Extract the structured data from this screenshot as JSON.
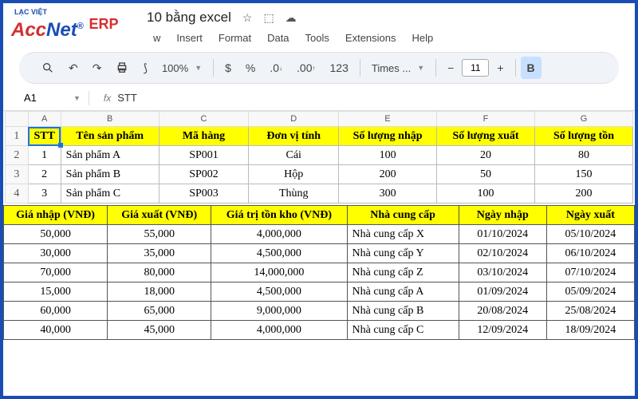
{
  "logo": {
    "lac": "LẠC VIỆT",
    "acc": "Acc",
    "net": "Net",
    "erp": "ERP",
    "reg": "®"
  },
  "doc": {
    "title": "10 bằng excel"
  },
  "menu": [
    "w",
    "Insert",
    "Format",
    "Data",
    "Tools",
    "Extensions",
    "Help"
  ],
  "toolbar": {
    "zoom": "100%",
    "font": "Times ...",
    "size": "11"
  },
  "namebox": "A1",
  "formula": "STT",
  "cols1": [
    "A",
    "B",
    "C",
    "D",
    "E",
    "F",
    "G"
  ],
  "headers1": [
    "STT",
    "Tên sản phẩm",
    "Mã hàng",
    "Đơn vị tính",
    "Số lượng nhập",
    "Số lượng xuất",
    "Số lượng tồn"
  ],
  "rows1": [
    {
      "n": "1",
      "stt": "1",
      "ten": "Sản phẩm A",
      "ma": "SP001",
      "dv": "Cái",
      "nhap": "100",
      "xuat": "20",
      "ton": "80"
    },
    {
      "n": "2",
      "stt": "2",
      "ten": "Sản phẩm B",
      "ma": "SP002",
      "dv": "Hộp",
      "nhap": "200",
      "xuat": "50",
      "ton": "150"
    },
    {
      "n": "3",
      "stt": "3",
      "ten": "Sản phẩm C",
      "ma": "SP003",
      "dv": "Thùng",
      "nhap": "300",
      "xuat": "100",
      "ton": "200"
    }
  ],
  "headers2": [
    "Giá nhập (VNĐ)",
    "Giá xuất (VNĐ)",
    "Giá trị tồn kho (VNĐ)",
    "Nhà cung cấp",
    "Ngày nhập",
    "Ngày xuất"
  ],
  "rows2": [
    {
      "gn": "50,000",
      "gx": "55,000",
      "gt": "4,000,000",
      "ncc": "Nhà cung cấp X",
      "nn": "01/10/2024",
      "nx": "05/10/2024"
    },
    {
      "gn": "30,000",
      "gx": "35,000",
      "gt": "4,500,000",
      "ncc": "Nhà cung cấp Y",
      "nn": "02/10/2024",
      "nx": "06/10/2024"
    },
    {
      "gn": "70,000",
      "gx": "80,000",
      "gt": "14,000,000",
      "ncc": "Nhà cung cấp Z",
      "nn": "03/10/2024",
      "nx": "07/10/2024"
    },
    {
      "gn": "15,000",
      "gx": "18,000",
      "gt": "4,500,000",
      "ncc": "Nhà cung cấp A",
      "nn": "01/09/2024",
      "nx": "05/09/2024"
    },
    {
      "gn": "60,000",
      "gx": "65,000",
      "gt": "9,000,000",
      "ncc": "Nhà cung cấp B",
      "nn": "20/08/2024",
      "nx": "25/08/2024"
    },
    {
      "gn": "40,000",
      "gx": "45,000",
      "gt": "4,000,000",
      "ncc": "Nhà cung cấp C",
      "nn": "12/09/2024",
      "nx": "18/09/2024"
    }
  ]
}
